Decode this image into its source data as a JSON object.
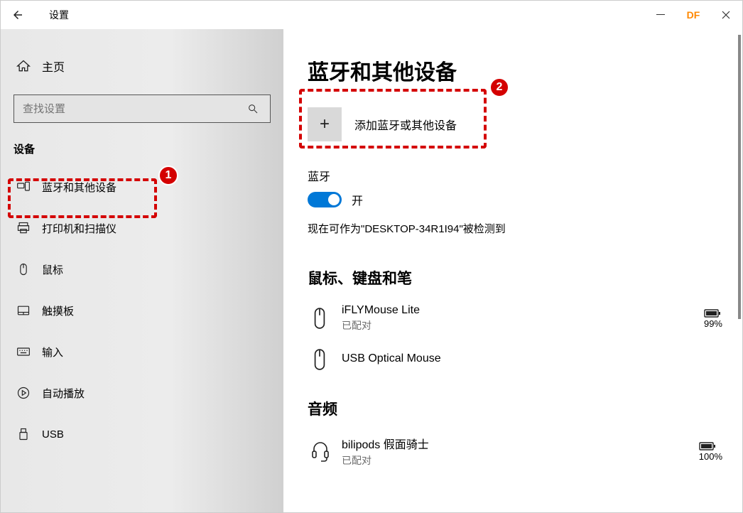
{
  "titlebar": {
    "title": "设置",
    "user_badge": "DF"
  },
  "sidebar": {
    "home_label": "主页",
    "search_placeholder": "查找设置",
    "category": "设备",
    "items": [
      {
        "label": "蓝牙和其他设备"
      },
      {
        "label": "打印机和扫描仪"
      },
      {
        "label": "鼠标"
      },
      {
        "label": "触摸板"
      },
      {
        "label": "输入"
      },
      {
        "label": "自动播放"
      },
      {
        "label": "USB"
      }
    ]
  },
  "content": {
    "page_title": "蓝牙和其他设备",
    "add_device_label": "添加蓝牙或其他设备",
    "bluetooth_label": "蓝牙",
    "bluetooth_state": "开",
    "discoverable_text": "现在可作为\"DESKTOP-34R1I94\"被检测到",
    "group_mouse_kb": "鼠标、键盘和笔",
    "group_audio": "音频",
    "devices_mkb": [
      {
        "name": "iFLYMouse Lite",
        "status": "已配对",
        "battery": "99%"
      },
      {
        "name": "USB Optical Mouse",
        "status": ""
      }
    ],
    "devices_audio": [
      {
        "name": "bilipods 假面骑士",
        "status": "已配对",
        "battery": "100%"
      }
    ]
  },
  "annotations": {
    "badge1": "1",
    "badge2": "2"
  }
}
